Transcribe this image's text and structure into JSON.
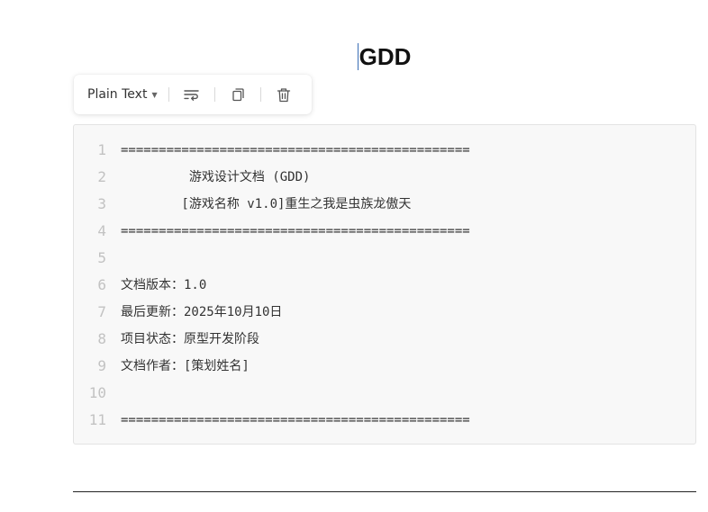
{
  "document": {
    "title": "GDD"
  },
  "code_toolbar": {
    "language": "Plain Text",
    "icons": {
      "wrap": "wrap-lines-icon",
      "copy": "copy-icon",
      "delete": "trash-icon"
    }
  },
  "code_block": {
    "lines": [
      {
        "number": "1",
        "text": "=============================================="
      },
      {
        "number": "2",
        "text": "         游戏设计文档 (GDD)"
      },
      {
        "number": "3",
        "text": "        [游戏名称 v1.0]重生之我是虫族龙傲天"
      },
      {
        "number": "4",
        "text": "=============================================="
      },
      {
        "number": "5",
        "text": ""
      },
      {
        "number": "6",
        "text": "文档版本：1.0"
      },
      {
        "number": "7",
        "text": "最后更新：2025年10月10日"
      },
      {
        "number": "8",
        "text": "项目状态：原型开发阶段"
      },
      {
        "number": "9",
        "text": "文档作者：[策划姓名]"
      },
      {
        "number": "10",
        "text": ""
      },
      {
        "number": "11",
        "text": "=============================================="
      }
    ]
  },
  "colors": {
    "code_background": "#f8f8f8",
    "line_number": "#c2c2c2",
    "caret": "#3a6db5"
  }
}
